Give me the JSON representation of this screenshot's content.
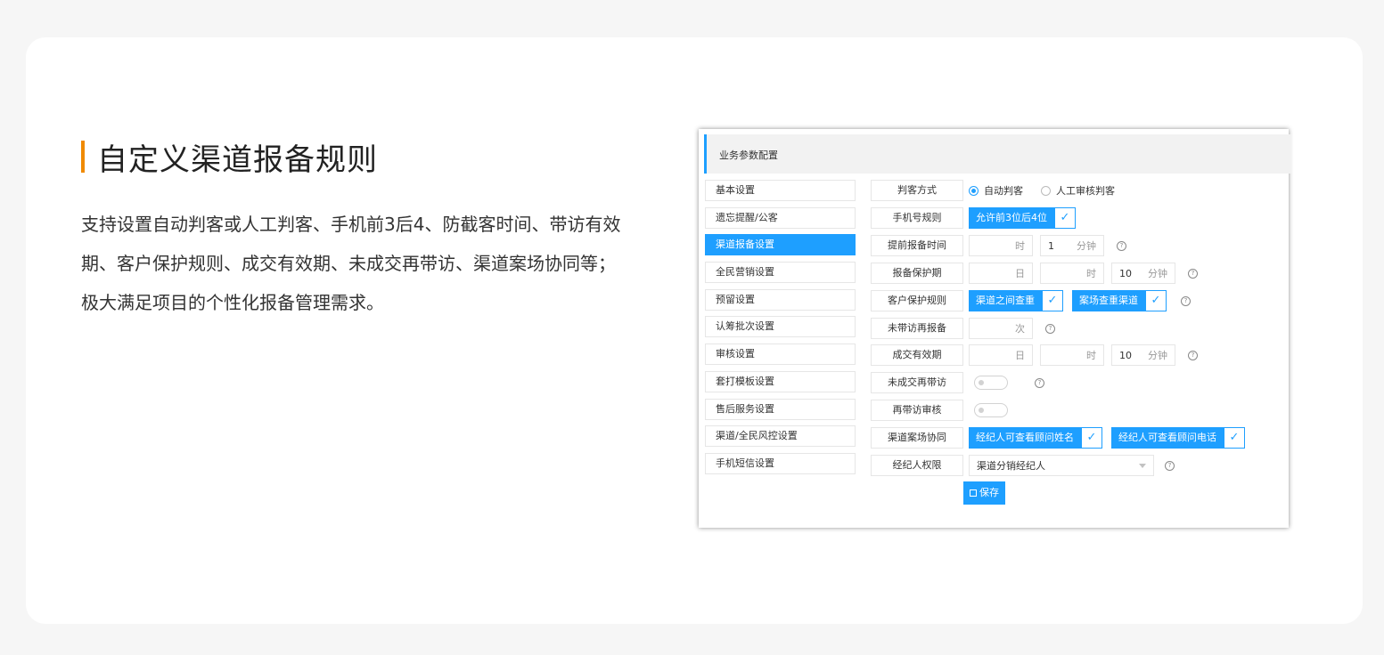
{
  "heading": "自定义渠道报备规则",
  "desc": [
    "支持设置自动判客或人工判客、手机前3后4、防截客时间、带访有效期、客户保护规则、成交有效期、未成交再带访、渠道案场协同等；",
    "极大满足项目的个性化报备管理需求。"
  ],
  "accent_color": "#f08a00",
  "brand_color": "#1e9fff",
  "panel_title": "业务参数配置",
  "menu": [
    "基本设置",
    "遗忘提醒/公客",
    "渠道报备设置",
    "全民营销设置",
    "预留设置",
    "认筹批次设置",
    "审核设置",
    "套打模板设置",
    "售后服务设置",
    "渠道/全民风控设置",
    "手机短信设置"
  ],
  "active_menu": "渠道报备设置",
  "form": {
    "judge": {
      "label": "判客方式",
      "opt1": "自动判客",
      "opt2": "人工审核判客",
      "selected": "自动判客"
    },
    "phone": {
      "label": "手机号规则",
      "tag": "允许前3位后4位"
    },
    "advance": {
      "label": "提前报备时间",
      "hour_unit": "时",
      "min_value": "1",
      "min_unit": "分钟"
    },
    "protect": {
      "label": "报备保护期",
      "day_unit": "日",
      "hour_unit": "时",
      "min_value": "10",
      "min_unit": "分钟"
    },
    "customer": {
      "label": "客户保护规则",
      "tag1": "渠道之间查重",
      "tag2": "案场查重渠道"
    },
    "revisit": {
      "label": "未带访再报备",
      "unit": "次"
    },
    "deal": {
      "label": "成交有效期",
      "day_unit": "日",
      "hour_unit": "时",
      "min_value": "10",
      "min_unit": "分钟"
    },
    "nodeal": {
      "label": "未成交再带访"
    },
    "review": {
      "label": "再带访审核"
    },
    "collab": {
      "label": "渠道案场协同",
      "tag1": "经纪人可查看顾问姓名",
      "tag2": "经纪人可查看顾问电话"
    },
    "perm": {
      "label": "经纪人权限",
      "value": "渠道分销经纪人"
    }
  },
  "help_mark": "?",
  "check_mark": "✓",
  "save_label": "保存"
}
